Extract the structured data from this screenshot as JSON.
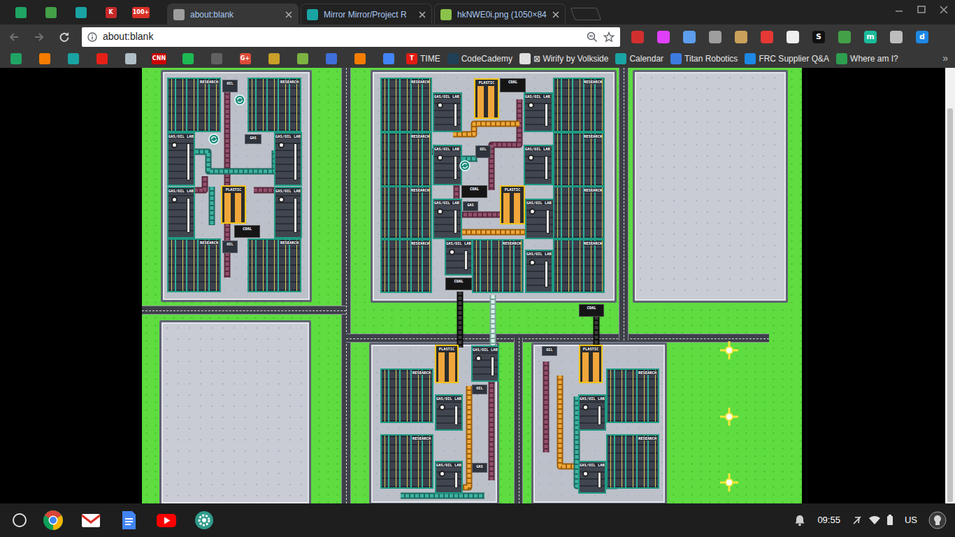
{
  "browser": {
    "pinned_tabs": [
      {
        "color": "#1fa463"
      },
      {
        "color": "#43a047"
      },
      {
        "color": "#1aa3a3"
      },
      {
        "glyph": "K",
        "color": "#c62828"
      },
      {
        "glyph": "100+",
        "color": "#d93025"
      }
    ],
    "tabs": [
      {
        "label": "about:blank",
        "selected": true,
        "color": "#9e9e9e"
      },
      {
        "label": "Mirror Mirror/Project R",
        "selected": false,
        "color": "#1aa3a3"
      },
      {
        "label": "hkNWE0i.png (1050×84",
        "selected": false,
        "color": "#8bc34a"
      }
    ],
    "address": "about:blank",
    "extensions": [
      {
        "color": "#d32f2f"
      },
      {
        "color": "#e040fb"
      },
      {
        "color": "#5c9ded"
      },
      {
        "color": "#9e9e9e"
      },
      {
        "color": "#c9a15a"
      },
      {
        "color": "#e53935"
      },
      {
        "color": "#eeeeee"
      },
      {
        "glyph": "S",
        "color": "#111111"
      },
      {
        "color": "#43a047"
      },
      {
        "glyph": "m",
        "color": "#1abc9c"
      },
      {
        "color": "#bdbdbd"
      },
      {
        "glyph": "d",
        "color": "#1e88e5"
      }
    ],
    "bookmarks": [
      {
        "color": "#1fa463"
      },
      {
        "color": "#f57c00"
      },
      {
        "color": "#1aa3a3"
      },
      {
        "color": "#e62117"
      },
      {
        "color": "#b0bec5"
      },
      {
        "glyph": "CNN",
        "color": "#cc0000"
      },
      {
        "color": "#1db954"
      },
      {
        "color": "#616161"
      },
      {
        "glyph": "G+",
        "color": "#dd4b39"
      },
      {
        "color": "#c8a02a"
      },
      {
        "color": "#7cb342"
      },
      {
        "color": "#3f6fd8"
      },
      {
        "color": "#f57d00"
      },
      {
        "color": "#4285f4"
      },
      {
        "label": "TIME",
        "glyph": "T",
        "color": "#e41b13"
      },
      {
        "label": "CodeCademy",
        "color": "#204056"
      },
      {
        "label": "⊠ Wirify by Volkside",
        "color": "#e0e0e0"
      },
      {
        "label": "Calendar",
        "color": "#1aa3a3"
      },
      {
        "label": "Titan Robotics",
        "color": "#3d7be0"
      },
      {
        "label": "FRC Supplier Q&A",
        "color": "#1e88e5"
      },
      {
        "label": "Where am I?",
        "color": "#2e9e4f"
      }
    ],
    "bookmarks_overflow": "»"
  },
  "content": {
    "scrollbar": {
      "level": 0.91
    }
  },
  "game": {
    "zones": [
      {
        "kind": "built",
        "buildings": [
          {
            "label": "RESEARCH",
            "kind": "research"
          },
          {
            "label": "OIL",
            "kind": "pump"
          },
          {
            "label": "RESEARCH",
            "kind": "research"
          },
          {
            "label": "GAS/OIL LAB",
            "kind": "lab"
          },
          {
            "label": "GAS",
            "kind": "pump"
          },
          {
            "label": "GAS/OIL LAB",
            "kind": "lab"
          },
          {
            "label": "GAS/OIL LAB",
            "kind": "lab"
          },
          {
            "label": "PLASTIC",
            "kind": "plastic"
          },
          {
            "label": "GAS/OIL LAB",
            "kind": "lab"
          },
          {
            "label": "COAL",
            "kind": "coal"
          },
          {
            "label": "RESEARCH",
            "kind": "research"
          },
          {
            "label": "OIL",
            "kind": "pump"
          },
          {
            "label": "RESEARCH",
            "kind": "research"
          }
        ]
      },
      {
        "kind": "built",
        "buildings": [
          {
            "label": "RESEARCH",
            "kind": "research"
          },
          {
            "label": "GAS/OIL LAB",
            "kind": "lab"
          },
          {
            "label": "PLASTIC",
            "kind": "plastic"
          },
          {
            "label": "COAL",
            "kind": "coal"
          },
          {
            "label": "GAS/OIL LAB",
            "kind": "lab"
          },
          {
            "label": "RESEARCH",
            "kind": "research"
          },
          {
            "label": "RESEARCH",
            "kind": "research"
          },
          {
            "label": "GAS/OIL LAB",
            "kind": "lab"
          },
          {
            "label": "OIL",
            "kind": "pump"
          },
          {
            "label": "GAS/OIL LAB",
            "kind": "lab"
          },
          {
            "label": "RESEARCH",
            "kind": "research"
          },
          {
            "label": "RESEARCH",
            "kind": "research"
          },
          {
            "label": "GAS/OIL LAB",
            "kind": "lab"
          },
          {
            "label": "COAL",
            "kind": "coal"
          },
          {
            "label": "GAS",
            "kind": "pump"
          },
          {
            "label": "PLASTIC",
            "kind": "plastic"
          },
          {
            "label": "GAS/OIL LAB",
            "kind": "lab"
          },
          {
            "label": "RESEARCH",
            "kind": "research"
          },
          {
            "label": "RESEARCH",
            "kind": "research"
          },
          {
            "label": "GAS/OIL LAB",
            "kind": "lab"
          },
          {
            "label": "RESEARCH",
            "kind": "research"
          },
          {
            "label": "GAS/OIL LAB",
            "kind": "lab"
          },
          {
            "label": "RESEARCH",
            "kind": "research"
          },
          {
            "label": "COAL",
            "kind": "coal"
          }
        ]
      },
      {
        "kind": "empty",
        "buildings": []
      },
      {
        "kind": "empty",
        "buildings": []
      },
      {
        "kind": "built",
        "buildings": [
          {
            "label": "PLASTIC",
            "kind": "plastic"
          },
          {
            "label": "GAS/OIL LAB",
            "kind": "lab"
          },
          {
            "label": "RESEARCH",
            "kind": "research"
          },
          {
            "label": "GAS/OIL LAB",
            "kind": "lab"
          },
          {
            "label": "OIL",
            "kind": "pump"
          },
          {
            "label": "RESEARCH",
            "kind": "research"
          },
          {
            "label": "GAS/OIL LAB",
            "kind": "lab"
          },
          {
            "label": "GAS",
            "kind": "pump"
          }
        ]
      },
      {
        "kind": "built",
        "buildings": [
          {
            "label": "OIL",
            "kind": "pump"
          },
          {
            "label": "PLASTIC",
            "kind": "plastic"
          },
          {
            "label": "RESEARCH",
            "kind": "research"
          },
          {
            "label": "GAS/OIL LAB",
            "kind": "lab"
          },
          {
            "label": "RESEARCH",
            "kind": "research"
          },
          {
            "label": "GAS/OIL LAB",
            "kind": "lab"
          }
        ]
      }
    ],
    "loose": [
      {
        "label": "COAL",
        "kind": "coal"
      }
    ]
  },
  "shelf": {
    "apps": [
      {
        "kind": "chrome"
      },
      {
        "kind": "gmail"
      },
      {
        "kind": "docs"
      },
      {
        "kind": "youtube"
      },
      {
        "kind": "app"
      }
    ],
    "time": "09:55",
    "locale": "US"
  }
}
